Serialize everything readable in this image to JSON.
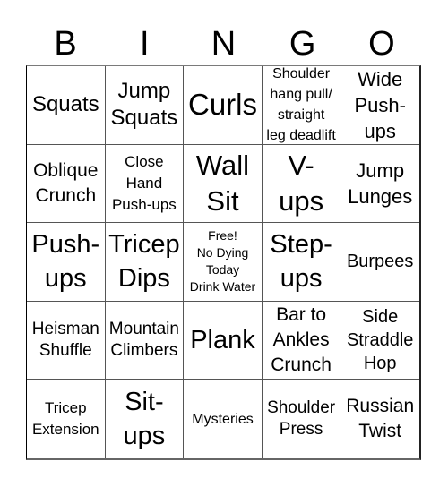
{
  "header": {
    "letters": [
      "B",
      "I",
      "N",
      "G",
      "O"
    ]
  },
  "cells": [
    {
      "text": "Squats",
      "row": 1,
      "col": 1
    },
    {
      "text": "Jump\nSquats",
      "row": 1,
      "col": 2
    },
    {
      "text": "Curls",
      "row": 1,
      "col": 3
    },
    {
      "text": "Shoulder\nhang pull/\nstraight\nleg deadlift",
      "row": 1,
      "col": 4
    },
    {
      "text": "Wide\nPush-\nups",
      "row": 1,
      "col": 5
    },
    {
      "text": "Oblique\nCrunch",
      "row": 2,
      "col": 1
    },
    {
      "text": "Close\nHand\nPush-ups",
      "row": 2,
      "col": 2
    },
    {
      "text": "Wall\nSit",
      "row": 2,
      "col": 3
    },
    {
      "text": "V-\nups",
      "row": 2,
      "col": 4
    },
    {
      "text": "Jump\nLunges",
      "row": 2,
      "col": 5
    },
    {
      "text": "Push-\nups",
      "row": 3,
      "col": 1
    },
    {
      "text": "Tricep\nDips",
      "row": 3,
      "col": 2
    },
    {
      "text": "Free!\nNo Dying\nToday\nDrink Water",
      "row": 3,
      "col": 3,
      "free_space": true
    },
    {
      "text": "Step-\nups",
      "row": 3,
      "col": 4
    },
    {
      "text": "Burpees",
      "row": 3,
      "col": 5
    },
    {
      "text": "Heisman\nShuffle",
      "row": 4,
      "col": 1
    },
    {
      "text": "Mountain\nClimbers",
      "row": 4,
      "col": 2
    },
    {
      "text": "Plank",
      "row": 4,
      "col": 3
    },
    {
      "text": "Bar to\nAnkles\nCrunch",
      "row": 4,
      "col": 4
    },
    {
      "text": "Side\nStraddle\nHop",
      "row": 4,
      "col": 5
    },
    {
      "text": "Tricep\nExtension",
      "row": 5,
      "col": 1
    },
    {
      "text": "Sit-\nups",
      "row": 5,
      "col": 2
    },
    {
      "text": "Mysteries",
      "row": 5,
      "col": 3
    },
    {
      "text": "Shoulder\nPress",
      "row": 5,
      "col": 4
    },
    {
      "text": "Russian\nTwist",
      "row": 5,
      "col": 5
    }
  ]
}
